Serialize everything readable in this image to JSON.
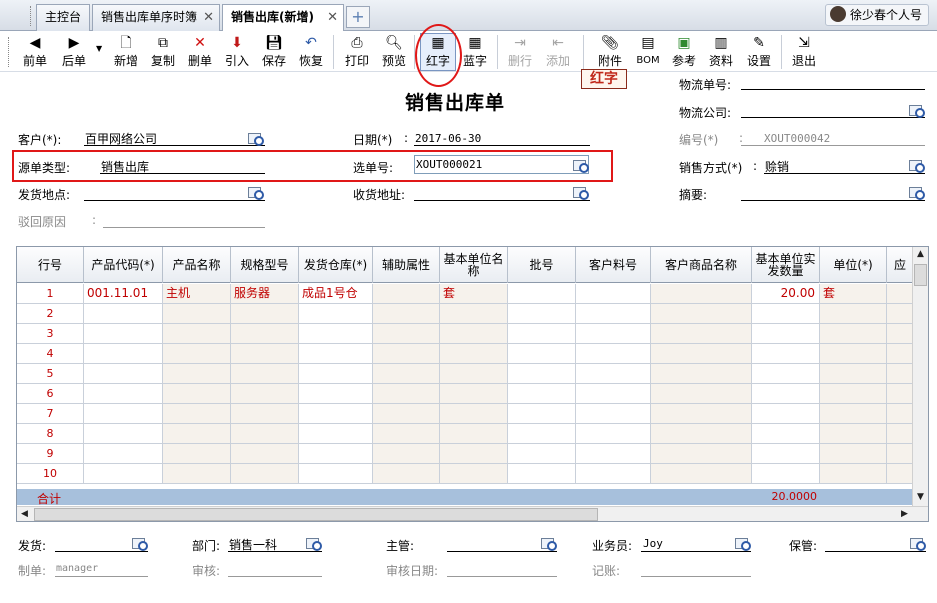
{
  "tabs": [
    {
      "label": "主控台"
    },
    {
      "label": "销售出库单序时簿"
    },
    {
      "label": "销售出库(新增)"
    }
  ],
  "user": {
    "name": "徐少春个人号"
  },
  "toolbar": {
    "prev": "前单",
    "next": "后单",
    "new": "新增",
    "copy": "复制",
    "delete": "删单",
    "import": "引入",
    "save": "保存",
    "restore": "恢复",
    "print": "打印",
    "preview": "预览",
    "red": "红字",
    "blue": "蓝字",
    "delete_row": "删行",
    "add_row": "添加",
    "attach": "附件",
    "bom": "BOM",
    "reference": "参考",
    "material": "资料",
    "settings": "设置",
    "exit": "退出"
  },
  "form": {
    "title": "销售出库单",
    "red_stamp": "红字",
    "customer_label": "客户(*):",
    "customer_value": "百甲网络公司",
    "date_label": "日期(*)",
    "date_value": "2017-06-30",
    "source_type_label": "源单类型:",
    "source_type_value": "销售出库",
    "select_no_label": "选单号:",
    "select_no_value": "XOUT000021",
    "ship_place_label": "发货地点:",
    "receive_addr_label": "收货地址:",
    "reject_reason_label": "驳回原因",
    "logistics_no_label": "物流单号:",
    "logistics_company_label": "物流公司:",
    "code_label": "编号(*)",
    "code_value": "XOUT000042",
    "sales_method_label": "销售方式(*)",
    "sales_method_value": "赊销",
    "summary_label": "摘要:"
  },
  "grid": {
    "headers": [
      "行号",
      "产品代码(*)",
      "产品名称",
      "规格型号",
      "发货仓库(*)",
      "辅助属性",
      "基本单位名称",
      "批号",
      "客户料号",
      "客户商品名称",
      "基本单位实发数量",
      "单位(*)",
      "应"
    ],
    "rows": [
      {
        "no": "1",
        "code": "001.11.01",
        "name": "主机",
        "spec": "服务器",
        "warehouse": "成品1号仓",
        "unit_name": "套",
        "qty": "20.00",
        "unit": "套"
      },
      {
        "no": "2"
      },
      {
        "no": "3"
      },
      {
        "no": "4"
      },
      {
        "no": "5"
      },
      {
        "no": "6"
      },
      {
        "no": "7"
      },
      {
        "no": "8"
      },
      {
        "no": "9"
      },
      {
        "no": "10"
      }
    ],
    "total_label": "合计",
    "total_qty": "20.0000"
  },
  "footer": {
    "ship_label": "发货:",
    "dept_label": "部门:",
    "dept_value": "销售一科",
    "manager_label": "主管:",
    "salesman_label": "业务员:",
    "salesman_value": "Joy",
    "keeper_label": "保管:",
    "maker_label": "制单:",
    "maker_value": "manager",
    "audit_label": "审核:",
    "audit_date_label": "审核日期:",
    "post_label": "记账:"
  }
}
